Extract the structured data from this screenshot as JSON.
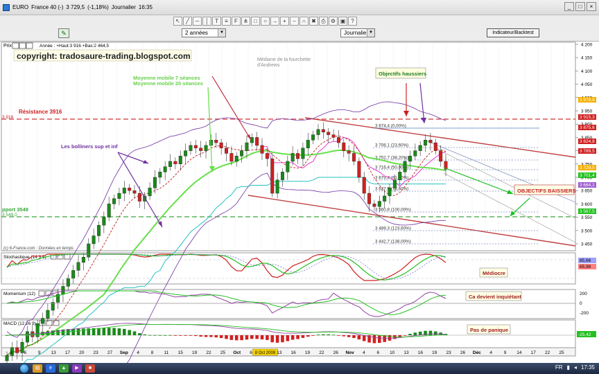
{
  "window": {
    "title_parts": [
      "EURO",
      "France 40 (-)",
      "3 729,5",
      "(-1,18%)",
      "Journalier",
      "16:35"
    ],
    "buttons": [
      "_",
      "□",
      "×"
    ]
  },
  "toolbar": {
    "period_select": "2 années",
    "interval_select": "Journalier",
    "indicator_button": "Indicateur/Backtest"
  },
  "price_panel": {
    "label": "Prix",
    "summary": "Année : +Haut:3 916 +Bas:2 464,5",
    "copyright": "copyright: tradosaure-trading.blogspot.com",
    "median_note": "Médiane de la fourchette d'Andrews",
    "ma7": "Moyenne mobile 7 séances",
    "ma20": "Moyenne mobile 20 séances",
    "objectifs_haussiers": "Objectifs haussiers",
    "objectifs_baissiers": "OBJECTIFS BAISSIERS",
    "resistance": "Résistance 3916",
    "resistance_left_value": "3 916",
    "bollinger": "Les bolliners sup et inf",
    "support": "pport 3549",
    "support_left_value": "3 549,0",
    "source_footer": "(c) 6-France.com : Données en temps",
    "fib_levels": [
      "3 874,4 (0,00%)",
      "3 708,1 (23,60%)",
      "3 752,7 (38,20%)",
      "3 716,4 (50,00%)",
      "3 679,4 (61,80%)",
      "3 627,9 (78,60%)",
      "3 560,8 (100,00%)",
      "3 489,3 (123,60%)",
      "3 442,7 (138,00%)"
    ],
    "y_ticks": [
      "4 200",
      "4 150",
      "4 100",
      "4 050",
      "4 000",
      "3 950",
      "3 900",
      "3 850",
      "3 800",
      "3 750",
      "3 700",
      "3 650",
      "3 600",
      "3 550",
      "3 500",
      "3 450"
    ],
    "right_tags": [
      "3 978,8",
      "3 915,3",
      "3 875,6",
      "3 824,8",
      "3 789,5",
      "3 729,5",
      "3 701,4",
      "3 664,1",
      "3 567,5"
    ]
  },
  "stoch_panel": {
    "label": "Stochastique (14 3 5)",
    "note": "Médiocre",
    "right_tags": [
      "85,66",
      "65,98"
    ]
  },
  "momentum_panel": {
    "label": "Momentum (12)",
    "note": "Ca devient inquiétant",
    "ticks": [
      "200",
      "0",
      "-200"
    ]
  },
  "macd_panel": {
    "label": "MACD (12 26 9)",
    "note": "Pas de panique",
    "right_tag": "-25,42"
  },
  "x_axis": {
    "labels": [
      "3",
      "6",
      "9",
      "13",
      "17",
      "20",
      "23",
      "27",
      "Sep",
      "4",
      "8",
      "11",
      "15",
      "19",
      "22",
      "25",
      "Oct",
      "6",
      "8 Oct 2009",
      "13",
      "16",
      "19",
      "22",
      "26",
      "Nov",
      "4",
      "6",
      "10",
      "13",
      "16",
      "19",
      "23",
      "26",
      "Déc",
      "4",
      "9",
      "14",
      "17",
      "22",
      "25"
    ],
    "highlight": "8 Oct 2009"
  },
  "taskbar": {
    "tray_lang": "FR",
    "clock": "17:35"
  },
  "colors": {
    "up_candle": "#1a8a1a",
    "down_candle": "#d02020",
    "ma7": "#c03030",
    "ma20": "#66e04a",
    "bollinger": "#7030a0",
    "channel": "#c04040",
    "annotation_green": "#19a020"
  }
}
